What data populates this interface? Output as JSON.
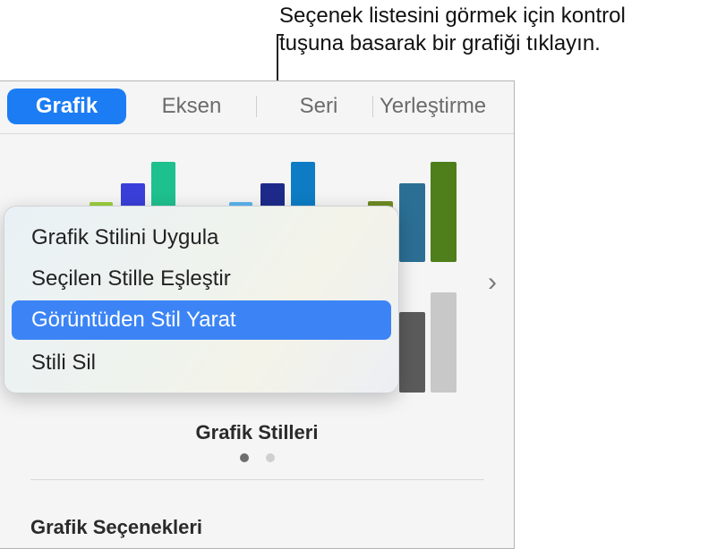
{
  "callout": {
    "line1": "Seçenek listesini görmek için kontrol",
    "line2": "tuşuna basarak bir grafiği tıklayın."
  },
  "tabs": [
    {
      "label": "Grafik",
      "active": true
    },
    {
      "label": "Eksen",
      "active": false
    },
    {
      "label": "Seri",
      "active": false
    },
    {
      "label": "Yerleştirme",
      "active": false
    }
  ],
  "styles_section": {
    "title": "Grafik Stilleri",
    "page_dots": 2,
    "current_page": 1
  },
  "options_section": {
    "title": "Grafik Seçenekleri"
  },
  "context_menu": {
    "items": [
      {
        "label": "Grafik Stilini Uygula",
        "selected": false
      },
      {
        "label": "Seçilen Stille Eşleştir",
        "selected": false
      },
      {
        "label": "Görüntüden Stil Yarat",
        "selected": true
      },
      {
        "label": "Stili Sil",
        "selected": false
      }
    ]
  },
  "colors": {
    "accent": "#1c7cf4",
    "menu_highlight": "#3c84f6"
  }
}
